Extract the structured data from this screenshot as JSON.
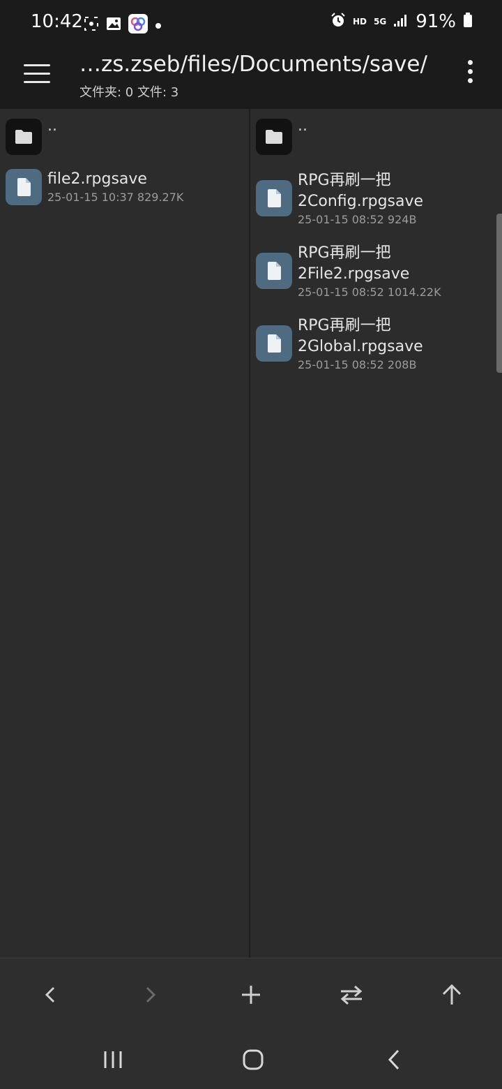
{
  "status_bar": {
    "time": "10:42",
    "left_icons": [
      "screenshot-icon",
      "gallery-icon",
      "app-icon",
      "notification-dot-icon"
    ],
    "right_icons": [
      "alarm-icon",
      "hd-icon",
      "5g-icon",
      "signal-icon",
      "battery-icon"
    ],
    "hd_label": "HD",
    "net_label": "5G",
    "battery": "91%"
  },
  "app_bar": {
    "path": "…zs.zseb/files/Documents/save/",
    "counts": "文件夹: 0  文件: 3"
  },
  "left_pane": {
    "parent_label": "..",
    "files": [
      {
        "name": "file2.rpgsave",
        "meta": "25-01-15 10:37  829.27K"
      }
    ]
  },
  "right_pane": {
    "parent_label": "..",
    "files": [
      {
        "name_line1": "RPG再刷一把",
        "name_line2": "2Config.rpgsave",
        "meta": "25-01-15 08:52  924B"
      },
      {
        "name_line1": "RPG再刷一把",
        "name_line2": "2File2.rpgsave",
        "meta": "25-01-15 08:52  1014.22K"
      },
      {
        "name_line1": "RPG再刷一把",
        "name_line2": "2Global.rpgsave",
        "meta": "25-01-15 08:52  208B"
      }
    ]
  },
  "bottom_toolbar": [
    "back-icon",
    "forward-icon",
    "add-icon",
    "swap-icon",
    "up-arrow-icon"
  ],
  "system_nav": [
    "recents-icon",
    "home-icon",
    "back-icon"
  ],
  "colors": {
    "app_bar_bg": "#1b1b1b",
    "pane_bg": "#2c2c2c",
    "file_icon_bg": "#4f6b82",
    "folder_icon_bg": "#121212"
  }
}
